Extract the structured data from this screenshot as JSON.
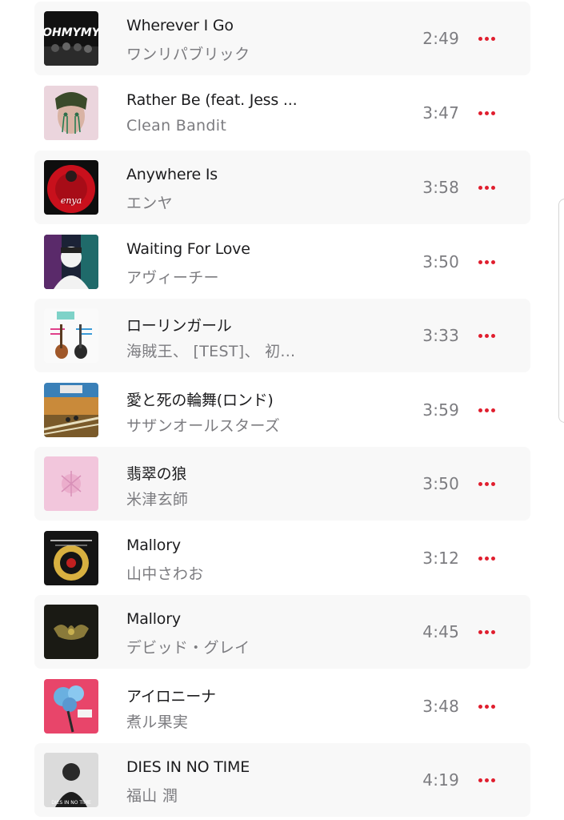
{
  "song_list": {
    "items": [
      {
        "title": "Wherever I Go",
        "artist": "ワンリパブリック",
        "duration": "2:49",
        "artwork_icon": "album-art-icon",
        "artwork_text": "OHMYMY"
      },
      {
        "title": "Rather Be (feat. Jess ...",
        "artist": "Clean Bandit",
        "duration": "3:47",
        "artwork_icon": "album-art-icon"
      },
      {
        "title": "Anywhere Is",
        "artist": "エンヤ",
        "duration": "3:58",
        "artwork_icon": "album-art-icon",
        "artwork_text": "enya"
      },
      {
        "title": "Waiting For Love",
        "artist": "アヴィーチー",
        "duration": "3:50",
        "artwork_icon": "album-art-icon"
      },
      {
        "title": "ローリンガール",
        "artist": "海賊王、 [TEST]、 初...",
        "duration": "3:33",
        "artwork_icon": "album-art-icon"
      },
      {
        "title": "愛と死の輪舞(ロンド)",
        "artist": "サザンオールスターズ",
        "duration": "3:59",
        "artwork_icon": "album-art-icon"
      },
      {
        "title": "翡翠の狼",
        "artist": "米津玄師",
        "duration": "3:50",
        "artwork_icon": "album-art-icon"
      },
      {
        "title": "Mallory",
        "artist": "山中さわお",
        "duration": "3:12",
        "artwork_icon": "album-art-icon"
      },
      {
        "title": "Mallory",
        "artist": "デビッド・グレイ",
        "duration": "4:45",
        "artwork_icon": "album-art-icon"
      },
      {
        "title": "アイロニーナ",
        "artist": "煮ル果実",
        "duration": "3:48",
        "artwork_icon": "album-art-icon"
      },
      {
        "title": "DIES IN NO TIME",
        "artist": "福山 潤",
        "duration": "4:19",
        "artwork_icon": "album-art-icon",
        "artwork_text": "DIES IN NO TIME"
      }
    ]
  },
  "colors": {
    "accent": "#e01e2e",
    "title_text": "#1c1c1e",
    "secondary_text": "#7c7c80",
    "row_shade": "#f8f8f8"
  },
  "icons": {
    "more": "more-options-icon"
  }
}
